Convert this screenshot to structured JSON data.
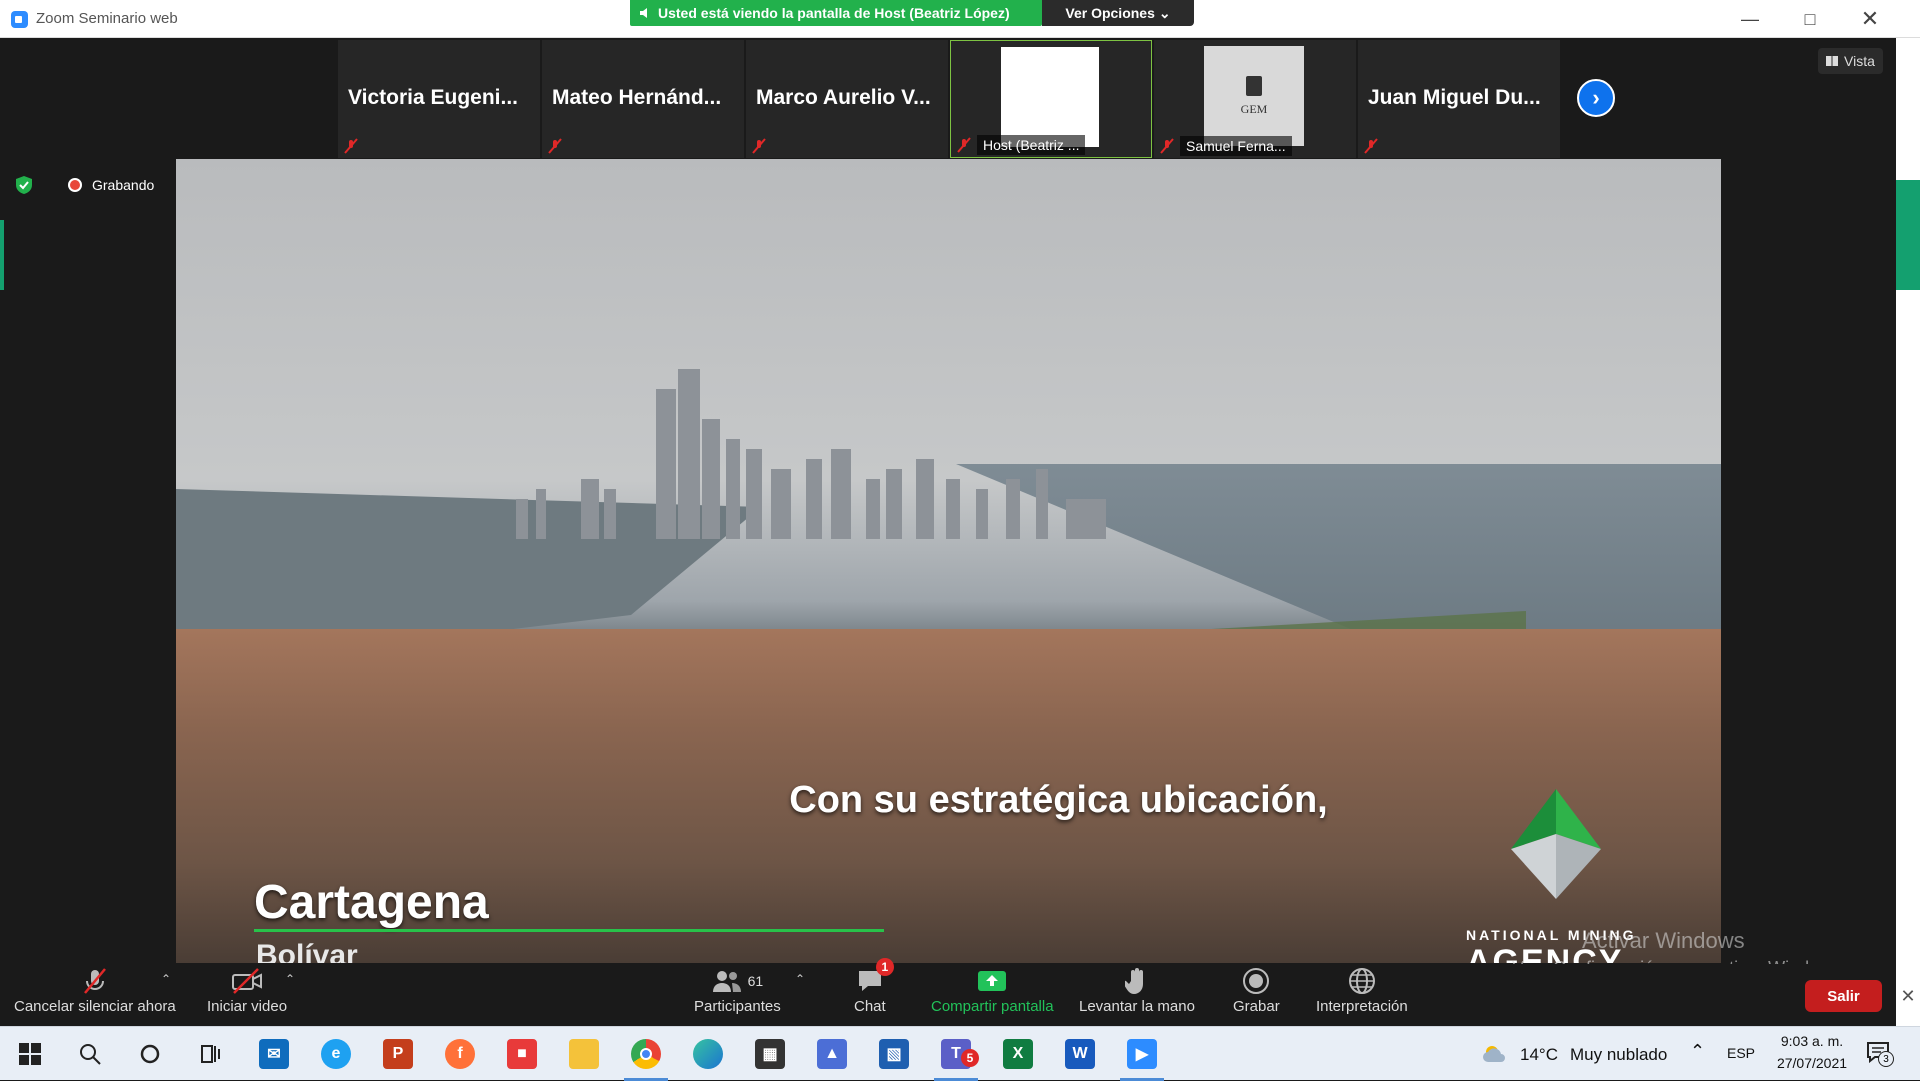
{
  "window": {
    "title": "Zoom Seminario web"
  },
  "banner": {
    "text": "Usted está viendo la pantalla de Host (Beatriz López)",
    "options_label": "Ver Opciones"
  },
  "view": {
    "label": "Vista"
  },
  "recording": {
    "label": "Grabando"
  },
  "participants_strip": [
    {
      "name": "Victoria  Eugeni...",
      "type": "name"
    },
    {
      "name": "Mateo  Hernánd...",
      "type": "name"
    },
    {
      "name": "Marco Aurelio V...",
      "type": "name"
    },
    {
      "name": "Host (Beatriz ...",
      "type": "video",
      "active": true
    },
    {
      "name": "Samuel Ferna...",
      "type": "logo",
      "logo_text": "GEM"
    },
    {
      "name": "Juan Miguel Du...",
      "type": "name"
    }
  ],
  "shared_screen": {
    "caption": "Con su estratégica ubicación,",
    "place": "Cartagena",
    "region": "Bolívar",
    "agency_line1": "NATIONAL MINING",
    "agency_line2": "AGENCY"
  },
  "watermark": {
    "line1": "Activar Windows",
    "line2": "Ve a Configuración para activar Windows."
  },
  "toolbar": {
    "unmute": "Cancelar silenciar ahora",
    "start_video": "Iniciar video",
    "participants": "Participantes",
    "participants_count": "61",
    "chat": "Chat",
    "chat_badge": "1",
    "share": "Compartir pantalla",
    "raise_hand": "Levantar la mano",
    "record": "Grabar",
    "interpretation": "Interpretación",
    "leave": "Salir"
  },
  "taskbar": {
    "weather_temp": "14°C",
    "weather_desc": "Muy nublado",
    "language": "ESP",
    "time": "9:03 a. m.",
    "date": "27/07/2021",
    "notifications": "3",
    "teams_badge": "5"
  },
  "colors": {
    "zoom_blue": "#2d8cff",
    "banner_green": "#22b14c",
    "leave_red": "#c41e1e",
    "share_green": "#22c25a"
  }
}
